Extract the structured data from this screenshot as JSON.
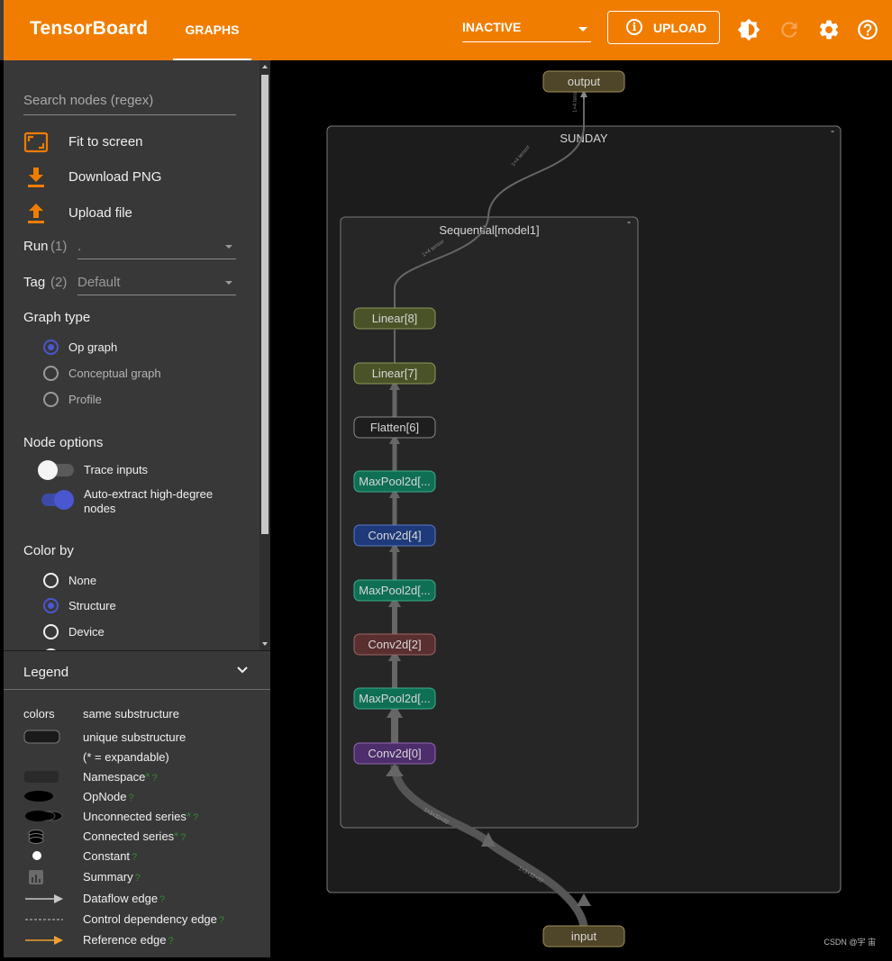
{
  "app": {
    "title": "TensorBoard"
  },
  "header": {
    "tab": "GRAPHS",
    "run_select": "INACTIVE",
    "upload_label": "UPLOAD",
    "upload_icon_glyph": "i",
    "icons": [
      "brightness-icon",
      "refresh-icon",
      "settings-icon",
      "help-icon"
    ]
  },
  "sidebar": {
    "search_placeholder": "Search nodes (regex)",
    "actions": [
      {
        "label": "Fit to screen",
        "icon": "fit-screen-icon"
      },
      {
        "label": "Download PNG",
        "icon": "download-icon"
      },
      {
        "label": "Upload file",
        "icon": "upload-icon"
      }
    ],
    "run": {
      "label": "Run",
      "count": "(1)",
      "value": "."
    },
    "tag": {
      "label": "Tag",
      "count": "(2)",
      "value": "Default"
    },
    "graph_type": {
      "title": "Graph type",
      "options": [
        "Op graph",
        "Conceptual graph",
        "Profile"
      ],
      "selected": "Op graph"
    },
    "node_options": {
      "title": "Node options",
      "trace_inputs": {
        "label": "Trace inputs",
        "on": false
      },
      "auto_extract": {
        "label_line1": "Auto-extract high-degree",
        "label_line2": "nodes",
        "on": true
      }
    },
    "color_by": {
      "title": "Color by",
      "options": [
        "None",
        "Structure",
        "Device"
      ],
      "selected": "Structure"
    }
  },
  "legend": {
    "title": "Legend",
    "colors_label": "colors",
    "same_substructure": "same substructure",
    "unique_substructure": "unique substructure",
    "expandable_note": "(* = expandable)",
    "items": [
      {
        "label": "Namespace",
        "asterisk": "*",
        "help": "?"
      },
      {
        "label": "OpNode",
        "asterisk": "",
        "help": "?"
      },
      {
        "label": "Unconnected series",
        "asterisk": "*",
        "help": "?"
      },
      {
        "label": "Connected series",
        "asterisk": "*",
        "help": "?"
      },
      {
        "label": "Constant",
        "asterisk": "",
        "help": "?"
      },
      {
        "label": "Summary",
        "asterisk": "",
        "help": "?"
      },
      {
        "label": "Dataflow edge",
        "asterisk": "",
        "help": "?"
      },
      {
        "label": "Control dependency edge",
        "asterisk": "",
        "help": "?"
      },
      {
        "label": "Reference edge",
        "asterisk": "",
        "help": "?"
      }
    ]
  },
  "graph": {
    "outer_namespace": "SUNDAY",
    "inner_namespace": "Sequential[model1]",
    "output_node": "output",
    "input_node": "input",
    "nodes": [
      "Linear[8]",
      "Linear[7]",
      "Flatten[6]",
      "MaxPool2d[...",
      "Conv2d[4]",
      "MaxPool2d[...",
      "Conv2d[2]",
      "MaxPool2d[...",
      "Conv2d[0]"
    ],
    "edge_labels": [
      "1×4 tensor",
      "1×4 tensor",
      "1×4 tensor",
      "1×3×32×32",
      "1×3×32×32"
    ],
    "colors": {
      "linear": "#4a5228",
      "flatten": "#1e1e1e",
      "maxpool": "#0e6f55",
      "conv4": "#1e3a7a",
      "conv2": "#5a2f2f",
      "conv0": "#4d2d6b",
      "io": "#4f4528",
      "accent": "#f07d00"
    }
  },
  "watermark": "CSDN @宇 宙"
}
